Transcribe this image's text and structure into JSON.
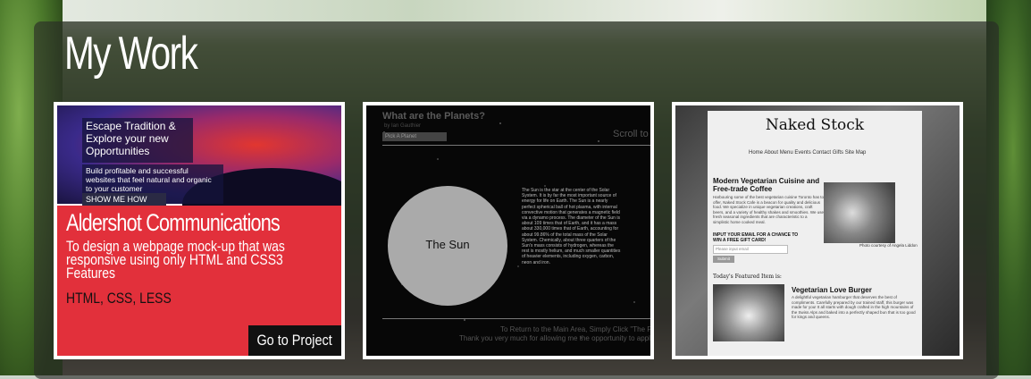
{
  "page": {
    "title": "My Work"
  },
  "projects": [
    {
      "preview": {
        "headline": "Escape Tradition & Explore your new Opportunities",
        "subtext": "Build profitable and successful websites that feel natural and organic to your customer",
        "button": "SHOW ME HOW"
      },
      "title": "Aldershot Communications",
      "description": "To design a webpage mock-up that was responsive using only HTML and CSS3 Features",
      "tags": "HTML, CSS, LESS",
      "link_label": "Go to Project"
    },
    {
      "preview": {
        "title": "What are the Planets?",
        "author": "by Ian Gauthier",
        "select": "Pick A Planet",
        "scroll": "Scroll to th",
        "sun_label": "The Sun",
        "body": "The Sun is the star at the center of the Solar System. It is by far the most important source of energy for life on Earth. The Sun is a nearly perfect spherical ball of hot plasma, with internal convective motion that generates a magnetic field via a dynamo process. The diameter of the Sun is about 109 times that of Earth, and it has a mass about 330,000 times that of Earth, accounting for about 99.86% of the total mass of the Solar System. Chemically, about three quarters of the Sun's mass consists of hydrogen, whereas the rest is mostly helium, and much smaller quantities of heavier elements, including oxygen, carbon, neon and iron.",
        "footer1": "To Return to the Main Area, Simply Click \"The Planets\" in th",
        "footer2": "Thank you very much for allowing me the opportunity to apply for the Junior W"
      }
    },
    {
      "preview": {
        "logo": "Naked Stock",
        "nav": "Home   About   Menu   Events   Contact   Gifts   Site Map",
        "headline": "Modern Vegetarian Cuisine and Free-trade Coffee",
        "body": "Harbouring some of the best vegetarian cuisine Toronto has to offer, Naked Stock Cafe is a beacon for quality and delicious food. We specialize in unique vegetarian creations, craft beers, and a variety of healthy shakes and smoothies. We use fresh seasonal ingredients that are characteristic to a simplistic home cooked meal.",
        "email_prompt": "INPUT YOUR EMAIL FOR A CHANCE TO WIN A FREE GIFT CARD!",
        "email_placeholder": "Please input email",
        "submit": "Submit",
        "photo_credit": "Photo courtesy of Angela Liddon",
        "featured": "Today's Featured Item is:",
        "burger_title": "Vegetarian Love Burger",
        "burger_body": "A delightful vegetarian hamburger that deserves the best of compliments. Carefully prepared by our trained staff, this burger was made for you! It all starts with dough crafted in the high mountains of the Swiss Alps and baked into a perfectly shaped bun that is too good for kings and queens."
      }
    }
  ]
}
